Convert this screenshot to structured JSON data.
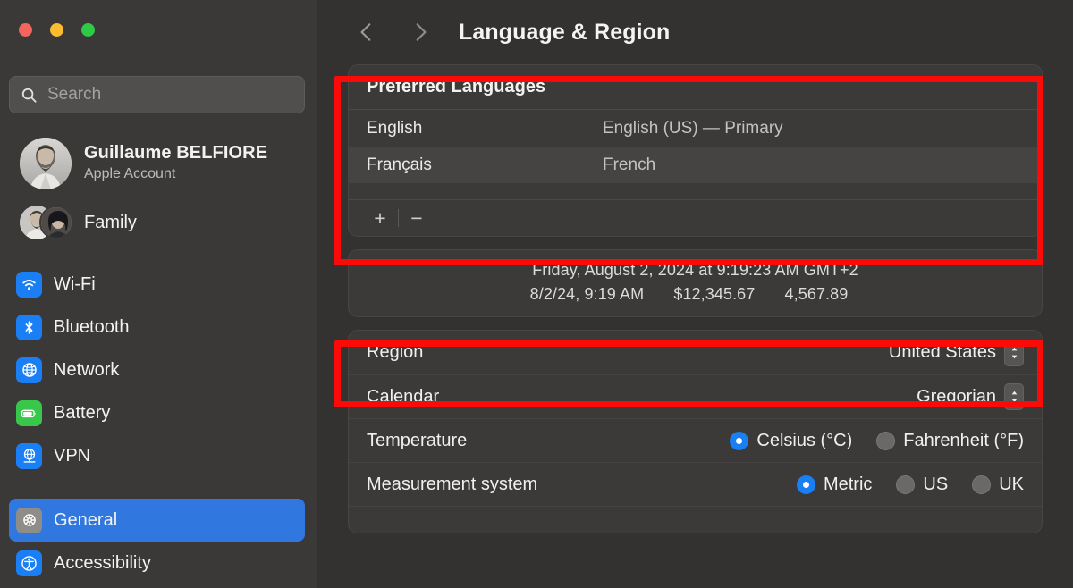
{
  "window": {
    "traffic_lights": [
      {
        "name": "close",
        "color": "#f4655d"
      },
      {
        "name": "minimize",
        "color": "#fbbd2f"
      },
      {
        "name": "zoom",
        "color": "#2fcb47"
      }
    ]
  },
  "sidebar": {
    "search": {
      "value": "",
      "placeholder": "Search"
    },
    "account": {
      "name": "Guillaume BELFIORE",
      "subtitle": "Apple Account"
    },
    "family": {
      "label": "Family"
    },
    "items": [
      {
        "label": "Wi-Fi",
        "icon": "wifi-icon",
        "icon_color": "#1a7ef5",
        "selected": false
      },
      {
        "label": "Bluetooth",
        "icon": "bluetooth-icon",
        "icon_color": "#1a7ef5",
        "selected": false
      },
      {
        "label": "Network",
        "icon": "globe-icon",
        "icon_color": "#1a7ef5",
        "selected": false
      },
      {
        "label": "Battery",
        "icon": "battery-icon",
        "icon_color": "#38c74a",
        "selected": false
      },
      {
        "label": "VPN",
        "icon": "vpn-globe-icon",
        "icon_color": "#1a7ef5",
        "selected": false
      },
      {
        "label": "General",
        "icon": "gear-icon",
        "icon_color": "#8e8d8a",
        "selected": true
      },
      {
        "label": "Accessibility",
        "icon": "accessibility-icon",
        "icon_color": "#1a7ef5",
        "selected": false
      }
    ],
    "selection_color": "#3077e0"
  },
  "header": {
    "back_icon": "chevron-left-icon",
    "forward_icon": "chevron-right-icon",
    "title": "Language & Region"
  },
  "languages_panel": {
    "title": "Preferred Languages",
    "rows": [
      {
        "name": "English",
        "description": "English (US) — Primary"
      },
      {
        "name": "Français",
        "description": "French"
      }
    ],
    "add_label": "+",
    "remove_label": "−"
  },
  "format_preview": {
    "line1": "Friday, August 2, 2024 at 9:19:23 AM GMT+2",
    "line2_date": "8/2/24, 9:19 AM",
    "line2_currency": "$12,345.67",
    "line2_number": "4,567.89"
  },
  "region_settings": {
    "region": {
      "label": "Region",
      "value": "United States"
    },
    "calendar": {
      "label": "Calendar",
      "value": "Gregorian"
    },
    "temperature": {
      "label": "Temperature",
      "options": [
        {
          "label": "Celsius (°C)",
          "selected": true
        },
        {
          "label": "Fahrenheit (°F)",
          "selected": false
        }
      ]
    },
    "measurement": {
      "label": "Measurement system",
      "options": [
        {
          "label": "Metric",
          "selected": true
        },
        {
          "label": "US",
          "selected": false
        },
        {
          "label": "UK",
          "selected": false
        }
      ]
    }
  },
  "annotations": {
    "color": "#fb0b08",
    "boxes": [
      {
        "name": "preferred-languages-highlight"
      },
      {
        "name": "region-highlight"
      }
    ]
  }
}
